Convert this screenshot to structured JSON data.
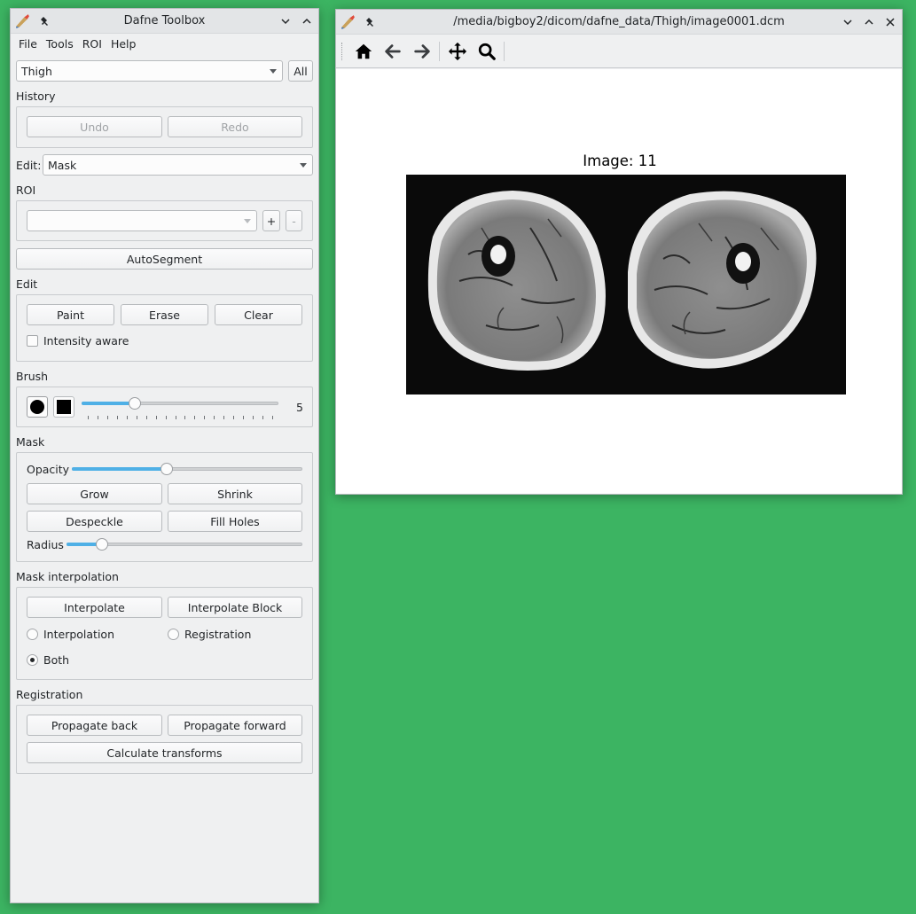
{
  "toolbox": {
    "title": "Dafne Toolbox",
    "menu": [
      "File",
      "Tools",
      "ROI",
      "Help"
    ],
    "dataset_value": "Thigh",
    "all_label": "All",
    "history_label": "History",
    "undo_label": "Undo",
    "redo_label": "Redo",
    "edit_label": "Edit:",
    "edit_value": "Mask",
    "roi_label": "ROI",
    "roi_value": "",
    "roi_add": "+",
    "roi_remove": "-",
    "autosegment_label": "AutoSegment",
    "edit_section_label": "Edit",
    "paint_label": "Paint",
    "erase_label": "Erase",
    "clear_label": "Clear",
    "intensity_aware_label": "Intensity aware",
    "intensity_aware_checked": false,
    "brush_label": "Brush",
    "brush_size": "5",
    "brush_slider_fraction": 0.27,
    "mask_label": "Mask",
    "opacity_label": "Opacity",
    "opacity_fraction": 0.41,
    "grow_label": "Grow",
    "shrink_label": "Shrink",
    "despeckle_label": "Despeckle",
    "fill_holes_label": "Fill Holes",
    "radius_label": "Radius",
    "radius_fraction": 0.15,
    "mask_interp_label": "Mask interpolation",
    "interpolate_label": "Interpolate",
    "interpolate_block_label": "Interpolate Block",
    "radio_interpolation": "Interpolation",
    "radio_registration": "Registration",
    "radio_both": "Both",
    "radio_selected": "Both",
    "registration_label": "Registration",
    "propagate_back_label": "Propagate back",
    "propagate_forward_label": "Propagate forward",
    "calc_transforms_label": "Calculate transforms"
  },
  "viewer": {
    "title": "/media/bigboy2/dicom/dafne_data/Thigh/image0001.dcm",
    "image_title": "Image: 11",
    "tools": [
      "home-icon",
      "back-arrow-icon",
      "forward-arrow-icon",
      "pan-icon",
      "zoom-icon"
    ]
  },
  "colors": {
    "desktop": "#3cb462",
    "accent": "#4fb0e6",
    "window_bg": "#eff0f1"
  }
}
